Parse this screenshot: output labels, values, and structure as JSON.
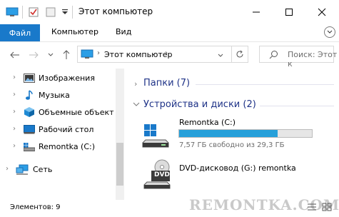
{
  "window": {
    "title": "Этот компьютер"
  },
  "ribbon": {
    "tabs": [
      {
        "label": "Файл",
        "active": true
      },
      {
        "label": "Компьютер"
      },
      {
        "label": "Вид"
      }
    ]
  },
  "navigation": {
    "address_path": "Этот компьютер",
    "search_placeholder": "Поиск: Этот к"
  },
  "sidebar": {
    "items": [
      {
        "label": "Изображения",
        "icon": "pictures-icon"
      },
      {
        "label": "Музыка",
        "icon": "music-icon"
      },
      {
        "label": "Объемные объекты",
        "icon": "3d-objects-icon"
      },
      {
        "label": "Рабочий стол",
        "icon": "desktop-icon"
      },
      {
        "label": "Remontka (C:)",
        "icon": "drive-icon"
      },
      {
        "label": "Сеть",
        "icon": "network-icon"
      }
    ]
  },
  "content": {
    "folders_group": "Папки (7)",
    "devices_group": "Устройства и диски (2)",
    "drives": [
      {
        "name": "Remontka (C:)",
        "free_text": "7,57 ГБ свободно из 29,3 ГБ",
        "used_fraction": 0.74
      },
      {
        "name": "DVD-дисковод (G:) remontka",
        "icon_text": "DVD"
      }
    ]
  },
  "statusbar": {
    "items_text": "Элементов: 9",
    "watermark": "REMONTKA.COM"
  },
  "colors": {
    "accent": "#1979ca",
    "group_heading": "#1e3287",
    "progress": "#26a0da"
  }
}
